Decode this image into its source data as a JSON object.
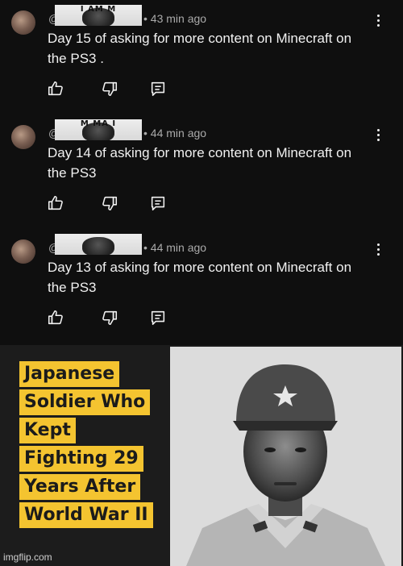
{
  "comments": [
    {
      "handle_prefix": "@",
      "handle_image_text_top": "I AM M",
      "handle_image_text_bottom": "",
      "timestamp": "• 43 min ago",
      "text_line1": "Day 15 of asking for more content on Minecraft on",
      "text_line2": "the PS3 ."
    },
    {
      "handle_prefix": "@",
      "handle_image_text_top": "M MA I",
      "handle_image_text_bottom": "",
      "timestamp": "• 44 min ago",
      "text_line1": "Day 14 of asking for more content on Minecraft on",
      "text_line2": "the PS3"
    },
    {
      "handle_prefix": "@",
      "handle_image_text_top": "",
      "handle_image_text_bottom": "",
      "timestamp": "• 44 min ago",
      "text_line1": "Day 13 of asking for more content on Minecraft on",
      "text_line2": "the PS3"
    }
  ],
  "icons": {
    "like": "thumbs-up-icon",
    "dislike": "thumbs-down-icon",
    "reply": "reply-icon",
    "menu": "kebab-menu-icon"
  },
  "meme": {
    "caption_lines": [
      "Japanese",
      "Soldier Who",
      "Kept",
      "Fighting 29",
      "Years After",
      "World War II"
    ],
    "caption_bg_color": "#f4c430",
    "watermark": "imgflip.com"
  }
}
